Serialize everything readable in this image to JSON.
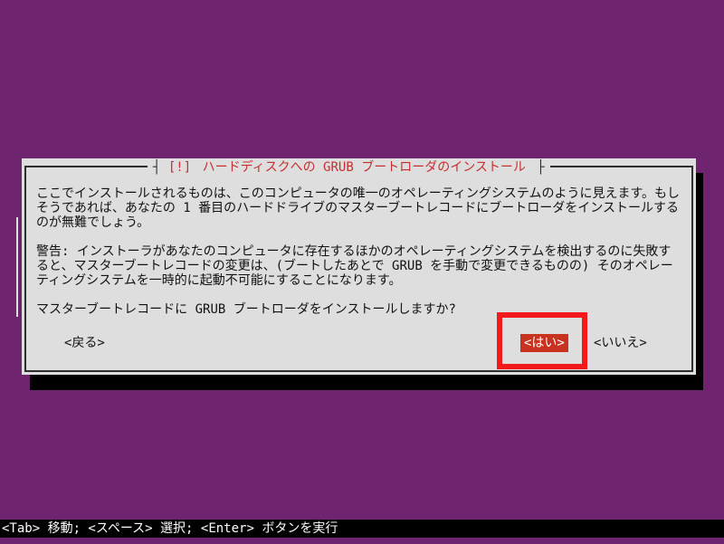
{
  "dialog": {
    "title_prefix": "[!]",
    "title": "ハードディスクへの GRUB ブートローダのインストール",
    "paragraphs": [
      "ここでインストールされるものは、このコンピュータの唯一のオペレーティングシステムのように見えます。もしそうであれば、あなたの 1 番目のハードドライブのマスターブートレコードにブートローダをインストールするのが無難でしょう。",
      "警告: インストーラがあなたのコンピュータに存在するほかのオペレーティングシステムを検出するのに失敗すると、マスターブートレコードの変更は、(ブートしたあとで GRUB を手動で変更できるものの) そのオペレーティングシステムを一時的に起動不可能にすることになります。",
      "マスターブートレコードに GRUB ブートローダをインストールしますか?"
    ],
    "buttons": {
      "back": "<戻る>",
      "yes": "<はい>",
      "no": "<いいえ>"
    }
  },
  "status_bar": {
    "text": "<Tab> 移動; <スペース> 選択; <Enter> ボタンを実行"
  },
  "colors": {
    "background": "#6e246e",
    "dialog_bg": "#dedede",
    "title": "#c43030",
    "selected_button_bg": "#c7331f",
    "highlight": "#f21a1a"
  }
}
